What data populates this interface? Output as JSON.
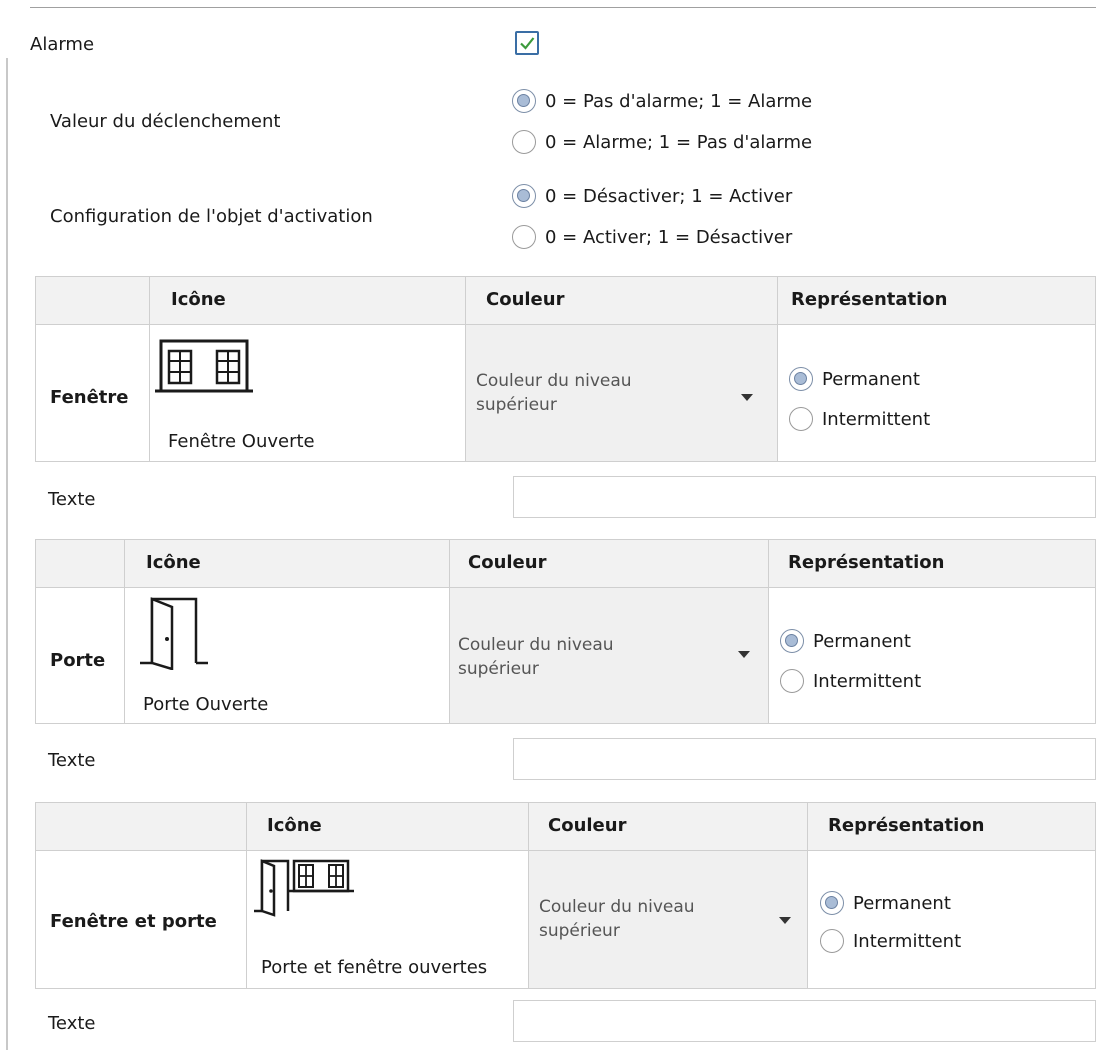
{
  "alarm": {
    "label": "Alarme",
    "checked": true
  },
  "trigger": {
    "label": "Valeur du déclenchement",
    "options": [
      "0 = Pas d'alarme; 1 = Alarme",
      "0 = Alarme; 1 = Pas d'alarme"
    ],
    "selected": 0
  },
  "activation": {
    "label": "Configuration de l'objet d'activation",
    "options": [
      "0 = Désactiver; 1 = Activer",
      "0 = Activer; 1 = Désactiver"
    ],
    "selected": 0
  },
  "tables": [
    {
      "row_label": "Fenêtre",
      "headers": {
        "icon": "Icône",
        "color": "Couleur",
        "representation": "Représentation"
      },
      "icon_name": "window-open-icon",
      "icon_caption": "Fenêtre Ouverte",
      "color_value": "Couleur du niveau supérieur",
      "representation": {
        "options": [
          "Permanent",
          "Intermittent"
        ],
        "selected": 0
      },
      "text_label": "Texte",
      "text_value": ""
    },
    {
      "row_label": "Porte",
      "headers": {
        "icon": "Icône",
        "color": "Couleur",
        "representation": "Représentation"
      },
      "icon_name": "door-open-icon",
      "icon_caption": "Porte Ouverte",
      "color_value": "Couleur du niveau supérieur",
      "representation": {
        "options": [
          "Permanent",
          "Intermittent"
        ],
        "selected": 0
      },
      "text_label": "Texte",
      "text_value": ""
    },
    {
      "row_label": "Fenêtre et porte",
      "headers": {
        "icon": "Icône",
        "color": "Couleur",
        "representation": "Représentation"
      },
      "icon_name": "door-and-window-open-icon",
      "icon_caption": "Porte et fenêtre ouvertes",
      "color_value": "Couleur du niveau supérieur",
      "representation": {
        "options": [
          "Permanent",
          "Intermittent"
        ],
        "selected": 0
      },
      "text_label": "Texte",
      "text_value": ""
    }
  ],
  "colors": {
    "checkbox_border": "#3a6ea5",
    "checkmark": "#3c9a3c",
    "header_bg": "#f2f2f2",
    "border": "#cfcfcf"
  }
}
